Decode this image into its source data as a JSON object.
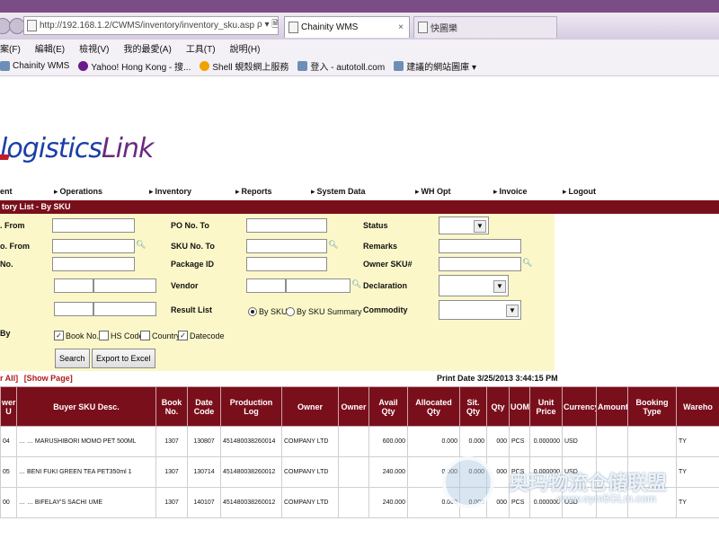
{
  "browser": {
    "url": "http://192.168.1.2/CWMS/inventory/inventory_sku.asp",
    "url_controls": "ρ ▾ 🗎 ⟳",
    "tabs": [
      {
        "label": "Chainity WMS",
        "close": "×"
      },
      {
        "label": "快圖樂"
      }
    ],
    "menu": [
      "案(F)",
      "編輯(E)",
      "檢視(V)",
      "我的最愛(A)",
      "工具(T)",
      "說明(H)"
    ],
    "favorites": [
      {
        "label": "Chainity WMS",
        "icon": "page-icon",
        "color": "#6d8fb7"
      },
      {
        "label": "Yahoo! Hong Kong - 搜...",
        "icon": "yahoo-icon",
        "color": "#6a1b8a"
      },
      {
        "label": "Shell 蜆殼網上服務",
        "icon": "shell-icon",
        "color": "#f2a200"
      },
      {
        "label": "登入 - autotoll.com",
        "icon": "page-icon",
        "color": "#6d8fb7"
      },
      {
        "label": "建議的網站圖庫 ▾",
        "icon": "page-icon",
        "color": "#6d8fb7"
      }
    ]
  },
  "logo": {
    "part1": "logistics",
    "part2": "Link"
  },
  "nav": {
    "items": [
      "ent",
      "Operations",
      "Inventory",
      "Reports",
      "System Data",
      "WH Opt",
      "Invoice",
      "Logout"
    ]
  },
  "page_title": "tory List - By SKU",
  "form": {
    "left_labels": [
      ". From",
      "o. From",
      "No.",
      "",
      "",
      "By"
    ],
    "po_no_to_label": "PO No. To",
    "sku_no_to_label": "SKU No. To",
    "package_id_label": "Package ID",
    "vendor_label": "Vendor",
    "result_list_label": "Result List",
    "status_label": "Status",
    "remarks_label": "Remarks",
    "owner_sku_label": "Owner SKU#",
    "declaration_label": "Declaration",
    "commodity_label": "Commodity",
    "result_options": [
      {
        "label": "By SKU",
        "checked": true
      },
      {
        "label": "By SKU Summary",
        "checked": false
      }
    ],
    "sort_options": [
      {
        "label": "Book No.",
        "checked": true
      },
      {
        "label": "HS Code",
        "checked": false
      },
      {
        "label": "Country",
        "checked": false
      },
      {
        "label": "Datecode",
        "checked": true
      }
    ],
    "search_button": "Search",
    "export_button": "Export to Excel"
  },
  "links": {
    "show_all": "r All]",
    "show_page": "[Show Page]"
  },
  "print_date": "Print Date 3/25/2013 3:44:15 PM",
  "table": {
    "headers": [
      "wer\nU",
      "Buyer SKU Desc.",
      "Book\nNo.",
      "Date\nCode",
      "Production\nLog",
      "Owner",
      "Owner",
      "Avail\nQty",
      "Allocated\nQty",
      "Sit.\nQty",
      "Qty",
      "UOM",
      "Unit\nPrice",
      "Currency",
      "Amount",
      "Booking\nType",
      "Wareho"
    ],
    "rows": [
      [
        "04",
        "… … MARUSHIBORI MOMO PET 500ML",
        "1307",
        "130807",
        "451480038260014",
        "COMPANY LTD",
        "",
        "600.000",
        "0.000",
        "0.000",
        "000",
        "PCS",
        "0.000000",
        "USD",
        "",
        "",
        "TY"
      ],
      [
        "05",
        "… BENI FUKI GREEN TEA PET350ml 1",
        "1307",
        "130714",
        "451480038260012",
        "COMPANY LTD",
        "",
        "240.000",
        "0.000",
        "0.000",
        "000",
        "PCS",
        "0.000000",
        "USD",
        "",
        "",
        "TY"
      ],
      [
        "00",
        "… … BIFELAY'S SACHI UME",
        "1307",
        "140107",
        "451480038260012",
        "COMPANY LTD",
        "",
        "240.000",
        "0.000",
        "0.000",
        "000",
        "PCS",
        "0.000000",
        "USD",
        "",
        "",
        "TY"
      ]
    ]
  },
  "watermark": {
    "text": "奥玛物流仓储联盟",
    "url": "www.oym5GLm.com"
  },
  "colors": {
    "maroon": "#7a0f1c",
    "form_bg": "#fbf7c8",
    "logo_blue": "#1a3ea8",
    "logo_purple": "#6a2a7e"
  }
}
